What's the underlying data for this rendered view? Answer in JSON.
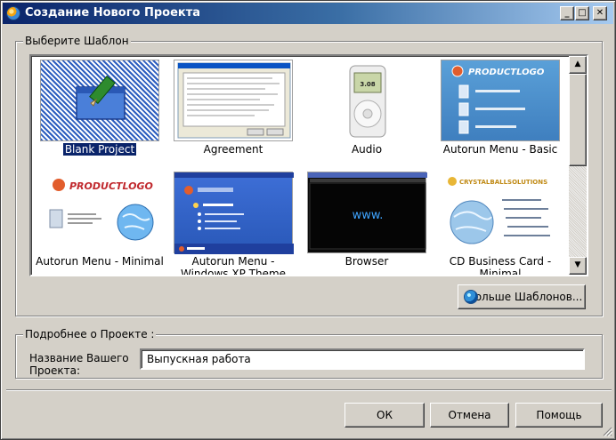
{
  "window": {
    "title": "Создание Нового Проекта",
    "controls": {
      "minimize": "_",
      "maximize": "□",
      "close": "✕"
    }
  },
  "templates": {
    "group_label": "Выберите Шаблон",
    "items": [
      {
        "label": "Blank Project",
        "selected": true,
        "icon": "pencil-icon"
      },
      {
        "label": "Agreement",
        "selected": false
      },
      {
        "label": "Audio",
        "selected": false,
        "screen_text": "3.08"
      },
      {
        "label": "Autorun Menu - Basic",
        "selected": false,
        "logo_text": "PRODUCTLOGO"
      },
      {
        "label": "Autorun Menu - Minimal",
        "selected": false,
        "logo_text": "PRODUCTLOGO"
      },
      {
        "label": "Autorun Menu - Windows XP Theme",
        "selected": false
      },
      {
        "label": "Browser",
        "selected": false,
        "screen_text": "www."
      },
      {
        "label": "CD Business Card - Minimal",
        "selected": false,
        "logo_text": "CRYSTALBALLSOLUTIONS"
      }
    ],
    "more_button_label": "ольше Шаблонов..."
  },
  "details": {
    "group_label": "Подробнее о Проекте :",
    "project_name_label": "Название Вашего Проекта:",
    "project_name_value": "Выпускная работа"
  },
  "buttons": {
    "ok": "ОК",
    "cancel": "Отмена",
    "help": "Помощь"
  },
  "colors": {
    "titlebar_start": "#0a246a",
    "titlebar_end": "#a6caf0",
    "selection": "#0a246a",
    "dialog_face": "#d4d0c8"
  }
}
